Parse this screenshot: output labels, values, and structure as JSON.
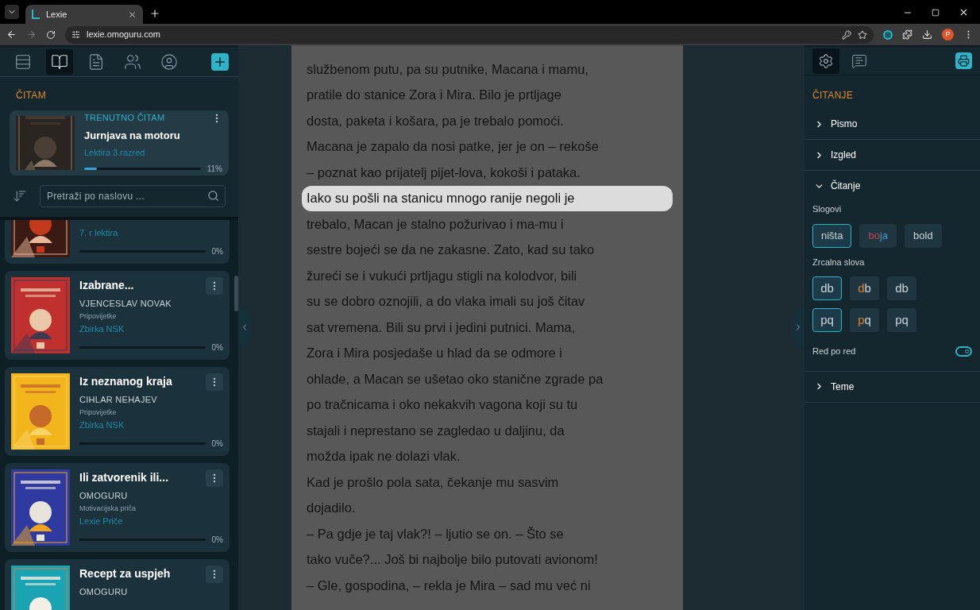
{
  "browser": {
    "tab_title": "Lexie",
    "url": "lexie.omoguru.com",
    "profile_initial": "P"
  },
  "sidebar": {
    "toolbar": [
      {
        "kind": "shelves",
        "selected": false
      },
      {
        "kind": "book",
        "selected": true
      },
      {
        "kind": "document",
        "selected": false
      },
      {
        "kind": "group",
        "selected": false
      },
      {
        "kind": "profile",
        "selected": false
      }
    ],
    "section_title": "ČITAM",
    "current": {
      "label": "TRENUTNO ČITAM",
      "title": "Jurnjava na motoru",
      "collection": "Lektira 3.razred",
      "level": 0.11,
      "percent": "11%"
    },
    "search": {
      "placeholder": "Pretraži po naslovu ..."
    },
    "books": [
      {
        "collection": "7. r lektira",
        "level": 0,
        "percent": "0%"
      },
      {
        "title": "Izabrane...",
        "author": "VJENCESLAV NOVAK",
        "genre": "Pripovijetke",
        "collection": "Zbirka NSK",
        "level": 0,
        "percent": "0%"
      },
      {
        "title": "Iz neznanog kraja",
        "author": "CIHLAR NEHAJEV",
        "genre": "Pripovijetke",
        "collection": "Zbirka NSK",
        "level": 0,
        "percent": "0%"
      },
      {
        "title": "Ili zatvorenik ili...",
        "author": "OMOGURU",
        "genre": "Motivacijska priča",
        "collection": "Lexie Priče",
        "level": 0,
        "percent": "0%"
      },
      {
        "title": "Recept za uspjeh",
        "author": "OMOGURU"
      }
    ]
  },
  "reader": {
    "lines": [
      {
        "text": "službenom putu, pa su putnike, Macana i mamu,",
        "selected": false
      },
      {
        "text": "pratile do stanice Zora i Mira. Bilo je prtljage",
        "selected": false
      },
      {
        "text": "dosta, paketa i košara, pa je trebalo pomoći.",
        "selected": false
      },
      {
        "text": "Macana je zapalo da nosi patke, jer je on – rekoše",
        "selected": false
      },
      {
        "text": "– poznat kao prijatelj pijet-lova, kokoši i pataka.",
        "selected": false
      },
      {
        "text": "Iako su pošli na stanicu mnogo ranije negoli je",
        "selected": true
      },
      {
        "text": "trebalo, Macan je stalno požurivao i ma-mu i",
        "selected": false
      },
      {
        "text": "sestre bojeći se da ne zakasne. Zato, kad su tako",
        "selected": false
      },
      {
        "text": "žureći se i vukući prtljagu stigli na kolodvor, bili",
        "selected": false
      },
      {
        "text": "su se dobro oznojili, a do vlaka imali su još čitav",
        "selected": false
      },
      {
        "text": "sat vremena. Bili su prvi i jedini putnici. Mama,",
        "selected": false
      },
      {
        "text": "Zora i Mira posjedaše u hlad da se odmore i",
        "selected": false
      },
      {
        "text": "ohlade, a Macan se ušetao oko stanične zgrade pa",
        "selected": false
      },
      {
        "text": "po tračnicama i oko nekakvih vagona koji su tu",
        "selected": false
      },
      {
        "text": "stajali i neprestano se zagledao u daljinu, da",
        "selected": false
      },
      {
        "text": "možda ipak ne dolazi vlak.",
        "selected": false
      },
      {
        "text": "Kad je prošlo pola sata, čekanje mu sasvim",
        "selected": false
      },
      {
        "text": "dojadilo.",
        "selected": false
      },
      {
        "text": "– Pa gdje je taj vlak?! – ljutio se on. – Što se",
        "selected": false
      },
      {
        "text": "tako vuče?... Još bi najbolje bilo putovati avionom!",
        "selected": false
      },
      {
        "text": "– Gle, gospodina, – rekla je Mira – sad mu već ni",
        "selected": false
      }
    ]
  },
  "settings": {
    "toolbar": [
      {
        "kind": "settings",
        "selected": true
      },
      {
        "kind": "audio",
        "selected": false
      }
    ],
    "section_title": "ČITANJE",
    "sections": [
      {
        "label": "Pismo",
        "expanded": false
      },
      {
        "label": "Izgled",
        "expanded": false
      },
      {
        "label": "Čitanje",
        "expanded": true,
        "syllables": {
          "label": "Slogovi",
          "options": [
            {
              "selected": true,
              "parts": [
                {
                  "text": "ništa"
                }
              ]
            },
            {
              "selected": false,
              "parts": [
                {
                  "text": "bo",
                  "color": "#c8434f"
                },
                {
                  "text": "ja",
                  "color": "#3a9fd6"
                }
              ]
            },
            {
              "selected": false,
              "parts": [
                {
                  "text": "bold"
                }
              ]
            }
          ]
        },
        "mirror": {
          "label": "Zrcalna slova",
          "rows": [
            [
              {
                "selected": true,
                "parts": [
                  {
                    "text": "db"
                  }
                ]
              },
              {
                "selected": false,
                "parts": [
                  {
                    "text": "d",
                    "color": "#d9822b"
                  },
                  {
                    "text": "b"
                  }
                ]
              },
              {
                "selected": false,
                "parts": [
                  {
                    "text": "db"
                  }
                ]
              }
            ],
            [
              {
                "selected": true,
                "parts": [
                  {
                    "text": "pq"
                  }
                ]
              },
              {
                "selected": false,
                "parts": [
                  {
                    "text": "p",
                    "color": "#d9822b"
                  },
                  {
                    "text": "q"
                  }
                ]
              },
              {
                "selected": false,
                "parts": [
                  {
                    "text": "pq"
                  }
                ]
              }
            ]
          ]
        },
        "line_by_line": {
          "label": "Red po red",
          "on": true
        }
      },
      {
        "label": "Teme",
        "expanded": false
      }
    ]
  }
}
